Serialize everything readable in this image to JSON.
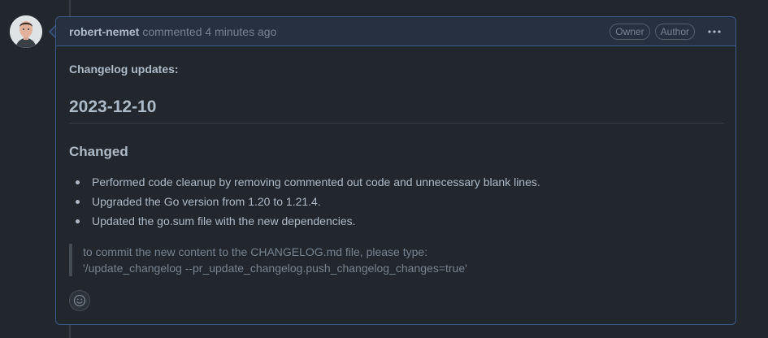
{
  "comment": {
    "author": "robert-nemet",
    "meta": "commented 4 minutes ago",
    "badges": [
      "Owner",
      "Author"
    ],
    "intro": "Changelog updates:",
    "heading": "2023-12-10",
    "subheading": "Changed",
    "items": [
      "Performed code cleanup by removing commented out code and unnecessary blank lines.",
      "Upgraded the Go version from 1.20 to 1.21.4.",
      "Updated the go.sum file with the new dependencies."
    ],
    "quote": [
      "to commit the new content to the CHANGELOG.md file, please type:",
      "'/update_changelog --pr_update_changelog.push_changelog_changes=true'"
    ]
  },
  "icons": {
    "more": "kebab-horizontal-icon",
    "reaction": "smiley-icon"
  },
  "colors": {
    "background": "#22272e",
    "header": "#263041",
    "border": "#3d5a8a",
    "text": "#adbac7",
    "muted": "#768390"
  }
}
